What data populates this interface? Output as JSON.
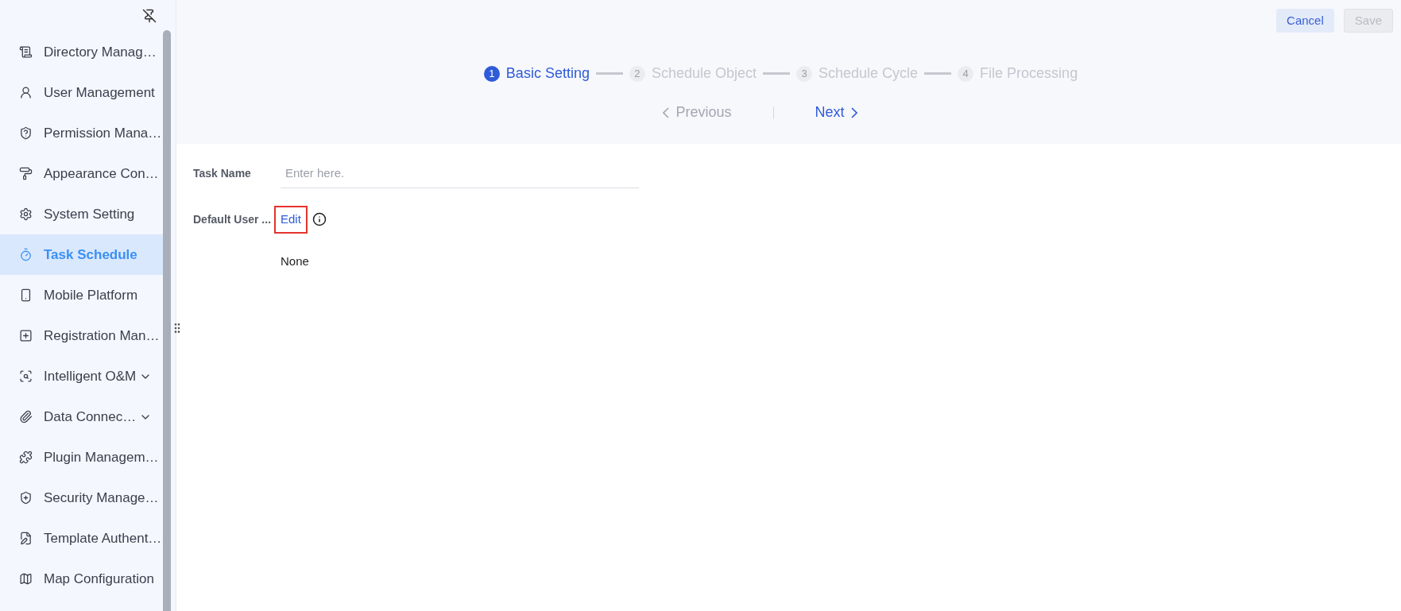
{
  "sidebar": {
    "items": [
      {
        "label": "Directory Manag…",
        "selected": false,
        "expandable": false
      },
      {
        "label": "User Management",
        "selected": false,
        "expandable": false
      },
      {
        "label": "Permission Mana…",
        "selected": false,
        "expandable": false
      },
      {
        "label": "Appearance Con…",
        "selected": false,
        "expandable": false
      },
      {
        "label": "System Setting",
        "selected": false,
        "expandable": false
      },
      {
        "label": "Task Schedule",
        "selected": true,
        "expandable": false
      },
      {
        "label": "Mobile Platform",
        "selected": false,
        "expandable": false
      },
      {
        "label": "Registration Man…",
        "selected": false,
        "expandable": false
      },
      {
        "label": "Intelligent O&M",
        "selected": false,
        "expandable": true
      },
      {
        "label": "Data Connec…",
        "selected": false,
        "expandable": true
      },
      {
        "label": "Plugin Managem…",
        "selected": false,
        "expandable": false
      },
      {
        "label": "Security Manage…",
        "selected": false,
        "expandable": false
      },
      {
        "label": "Template Authent…",
        "selected": false,
        "expandable": false
      },
      {
        "label": "Map Configuration",
        "selected": false,
        "expandable": false
      }
    ]
  },
  "toolbar": {
    "buttons": [
      {
        "label": "Cancel",
        "disabled": false
      },
      {
        "label": "Save",
        "disabled": true
      }
    ]
  },
  "steps": [
    {
      "number": "1",
      "label": "Basic Setting",
      "selected": true
    },
    {
      "number": "2",
      "label": "Schedule Object",
      "selected": false
    },
    {
      "number": "3",
      "label": "Schedule Cycle",
      "selected": false
    },
    {
      "number": "4",
      "label": "File Processing",
      "selected": false
    }
  ],
  "step_nav": {
    "previous": {
      "label": "Previous",
      "disabled": true
    },
    "next": {
      "label": "Next",
      "disabled": false
    }
  },
  "form": {
    "task_name": {
      "label": "Task Name",
      "placeholder": "Enter here."
    },
    "default_user": {
      "label": "Default User ...",
      "link": "Edit",
      "highlighted": true,
      "value": "None"
    }
  }
}
